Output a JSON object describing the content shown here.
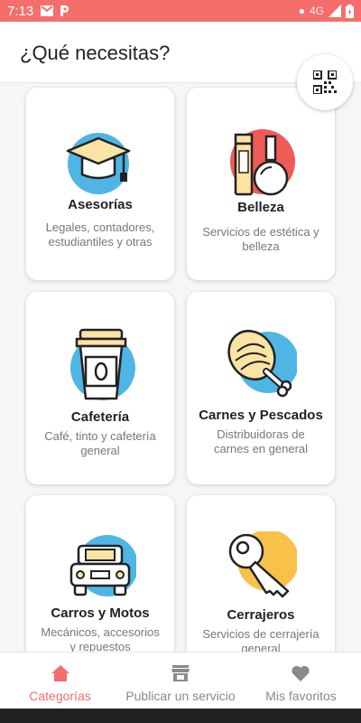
{
  "status_bar": {
    "time": "7:13",
    "left_icons": [
      "gmail-icon",
      "parking-app-icon"
    ],
    "network": "4G",
    "right_icons": [
      "notification-dot-icon",
      "signal-icon",
      "battery-icon"
    ]
  },
  "header": {
    "title": "¿Qué necesitas?",
    "qr_icon": "qr-code-icon"
  },
  "categories": [
    {
      "name": "Asesorías",
      "description": "Legales, contadores, estudiantiles y otras",
      "icon": "graduation-cap-icon"
    },
    {
      "name": "Belleza",
      "description": "Servicios de estética y belleza",
      "icon": "cosmetics-icon"
    },
    {
      "name": "Cafetería",
      "description": "Café, tinto y cafetería general",
      "icon": "coffee-cup-icon"
    },
    {
      "name": "Carnes y Pescados",
      "description": "Distribuidoras de carnes en general",
      "icon": "ham-icon"
    },
    {
      "name": "Carros y Motos",
      "description": "Mecánicos, accesorios y repuestos",
      "icon": "car-icon"
    },
    {
      "name": "Cerrajeros",
      "description": "Servicios de cerrajería general",
      "icon": "key-icon"
    }
  ],
  "bottom_nav": [
    {
      "label": "Categorías",
      "icon": "home-icon",
      "active": true
    },
    {
      "label": "Publicar un servicio",
      "icon": "store-icon",
      "active": false
    },
    {
      "label": "Mis favoritos",
      "icon": "heart-icon",
      "active": false
    }
  ],
  "colors": {
    "accent": "#f46f6c",
    "blue_circle": "#4fb5e4",
    "yellow_circle": "#f7c14a",
    "red_circle": "#ef5b57",
    "inactive": "#8a8a8a"
  }
}
